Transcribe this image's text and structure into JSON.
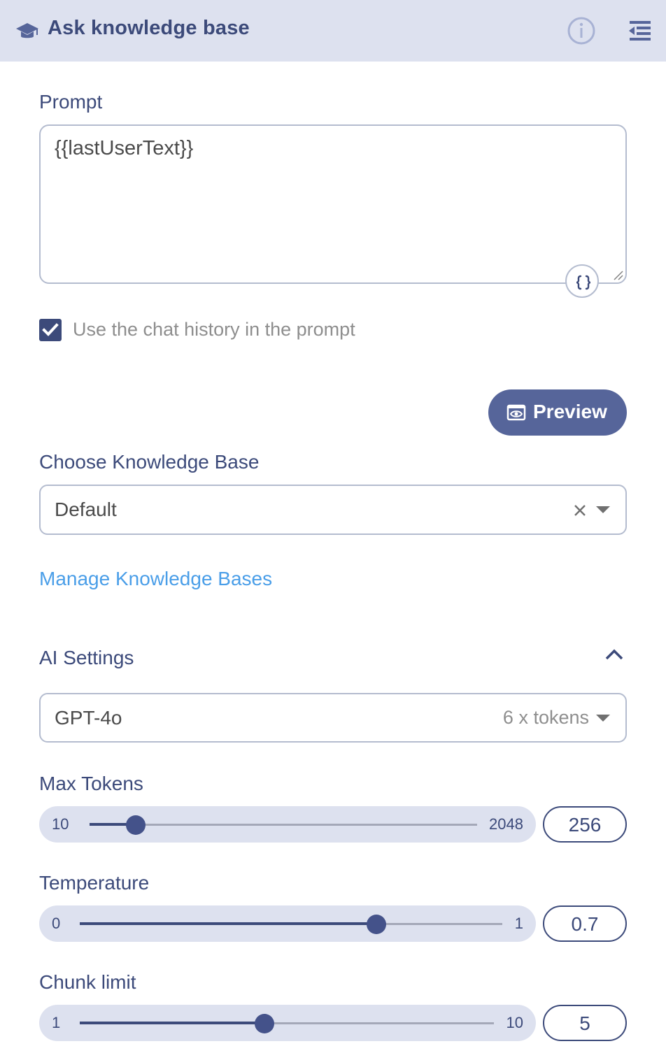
{
  "header": {
    "title": "Ask knowledge base",
    "icons": [
      "graduation-cap-icon",
      "info-icon",
      "collapse-panel-icon"
    ]
  },
  "prompt": {
    "label": "Prompt",
    "value": "{{lastUserText}}",
    "variable_icon": "curly-braces-icon"
  },
  "chat_history": {
    "label": "Use the chat history in the prompt",
    "checked": true
  },
  "preview": {
    "label": "Preview",
    "icon": "eye-icon"
  },
  "knowledge_base": {
    "label": "Choose Knowledge Base",
    "selected": "Default",
    "manage_link": "Manage Knowledge Bases"
  },
  "ai_settings": {
    "label": "AI Settings",
    "expanded": true,
    "model": {
      "selected": "GPT-4o",
      "cost_hint": "6 x tokens"
    },
    "max_tokens": {
      "label": "Max Tokens",
      "min": "10",
      "max": "2048",
      "value": "256"
    },
    "temperature": {
      "label": "Temperature",
      "min": "0",
      "max": "1",
      "value": "0.7"
    },
    "chunk_limit": {
      "label": "Chunk limit",
      "min": "1",
      "max": "10",
      "value": "5"
    }
  },
  "colors": {
    "primary": "#3c4a7a",
    "header_bg": "#dde1ef",
    "button_bg": "#56659a",
    "link": "#4a9ee8"
  }
}
